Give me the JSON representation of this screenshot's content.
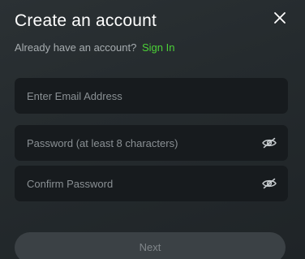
{
  "header": {
    "title": "Create an account",
    "close_icon": "close-icon"
  },
  "signin_prompt": {
    "text": "Already have an account?",
    "link_label": "Sign In"
  },
  "form": {
    "email": {
      "value": "",
      "placeholder": "Enter Email Address"
    },
    "password": {
      "value": "",
      "placeholder": "Password (at least 8 characters)",
      "icon": "eye-icon"
    },
    "confirm_password": {
      "value": "",
      "placeholder": "Confirm Password",
      "icon": "eye-icon"
    }
  },
  "actions": {
    "next_label": "Next"
  },
  "colors": {
    "background": "#262c2f",
    "field_background": "#171b1e",
    "link": "#4cd137",
    "button_background": "#3b4145",
    "button_text": "#80868a"
  }
}
